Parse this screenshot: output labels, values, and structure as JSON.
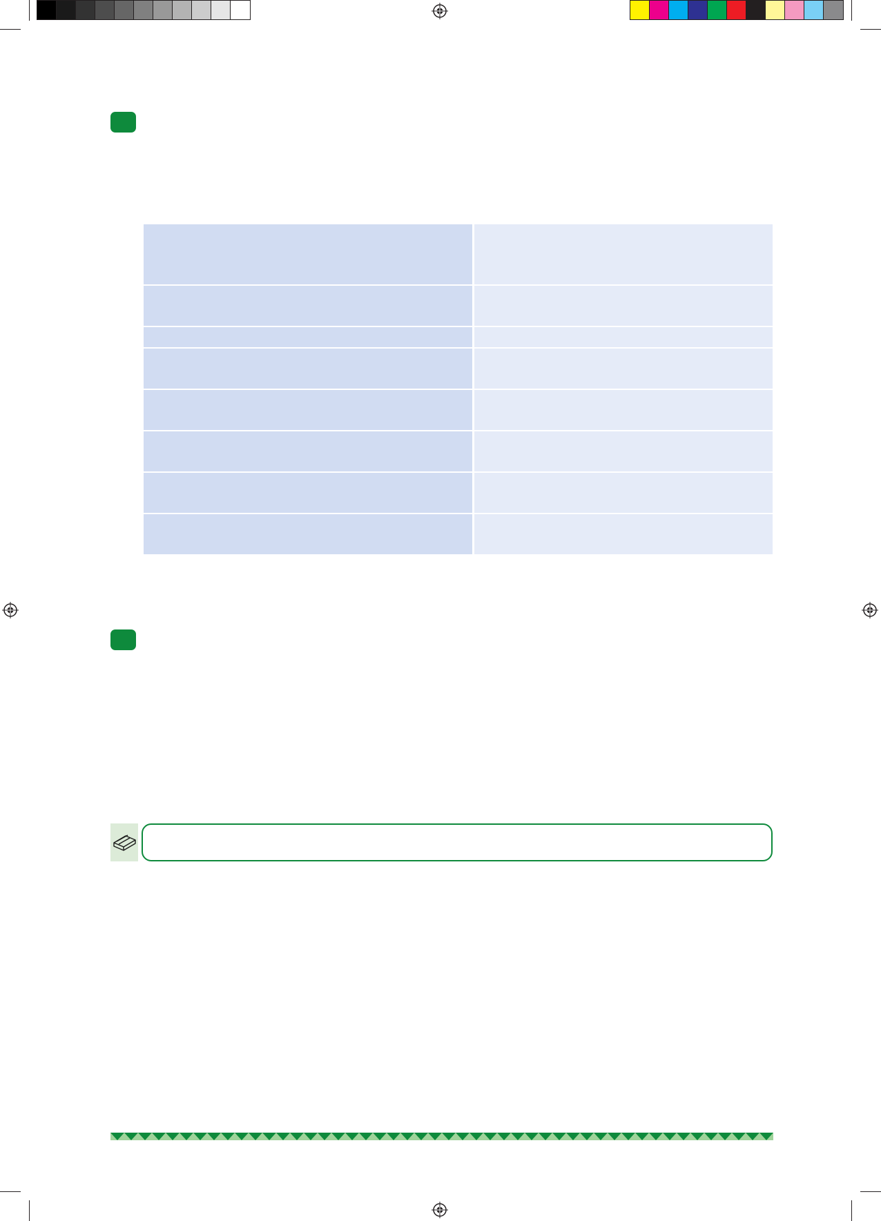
{
  "colors": {
    "accent_green": "#0e8a3c",
    "table_col_a": "#d1dcf2",
    "table_col_b": "#e5ebf8",
    "note_icon_bg": "#dcebd8"
  },
  "color_bar_gray": [
    "#000000",
    "#1a1a1a",
    "#333333",
    "#4d4d4d",
    "#666666",
    "#808080",
    "#999999",
    "#b3b3b3",
    "#cccccc",
    "#e6e6e6",
    "#ffffff"
  ],
  "color_bar_process": [
    "#fff200",
    "#ec008c",
    "#00aeef",
    "#2e3192",
    "#00a651",
    "#ed1c24",
    "#231f20",
    "#fff799",
    "#f49ac1",
    "#7ad0f5",
    "#8a8a8c"
  ],
  "table": {
    "rows": [
      {
        "left": "",
        "right": ""
      },
      {
        "left": "",
        "right": ""
      },
      {
        "left": "",
        "right": ""
      },
      {
        "left": "",
        "right": ""
      },
      {
        "left": "",
        "right": ""
      },
      {
        "left": "",
        "right": ""
      },
      {
        "left": "",
        "right": ""
      },
      {
        "left": "",
        "right": ""
      }
    ]
  },
  "icons": {
    "note": "book-icon",
    "registration": "registration-mark-icon"
  }
}
